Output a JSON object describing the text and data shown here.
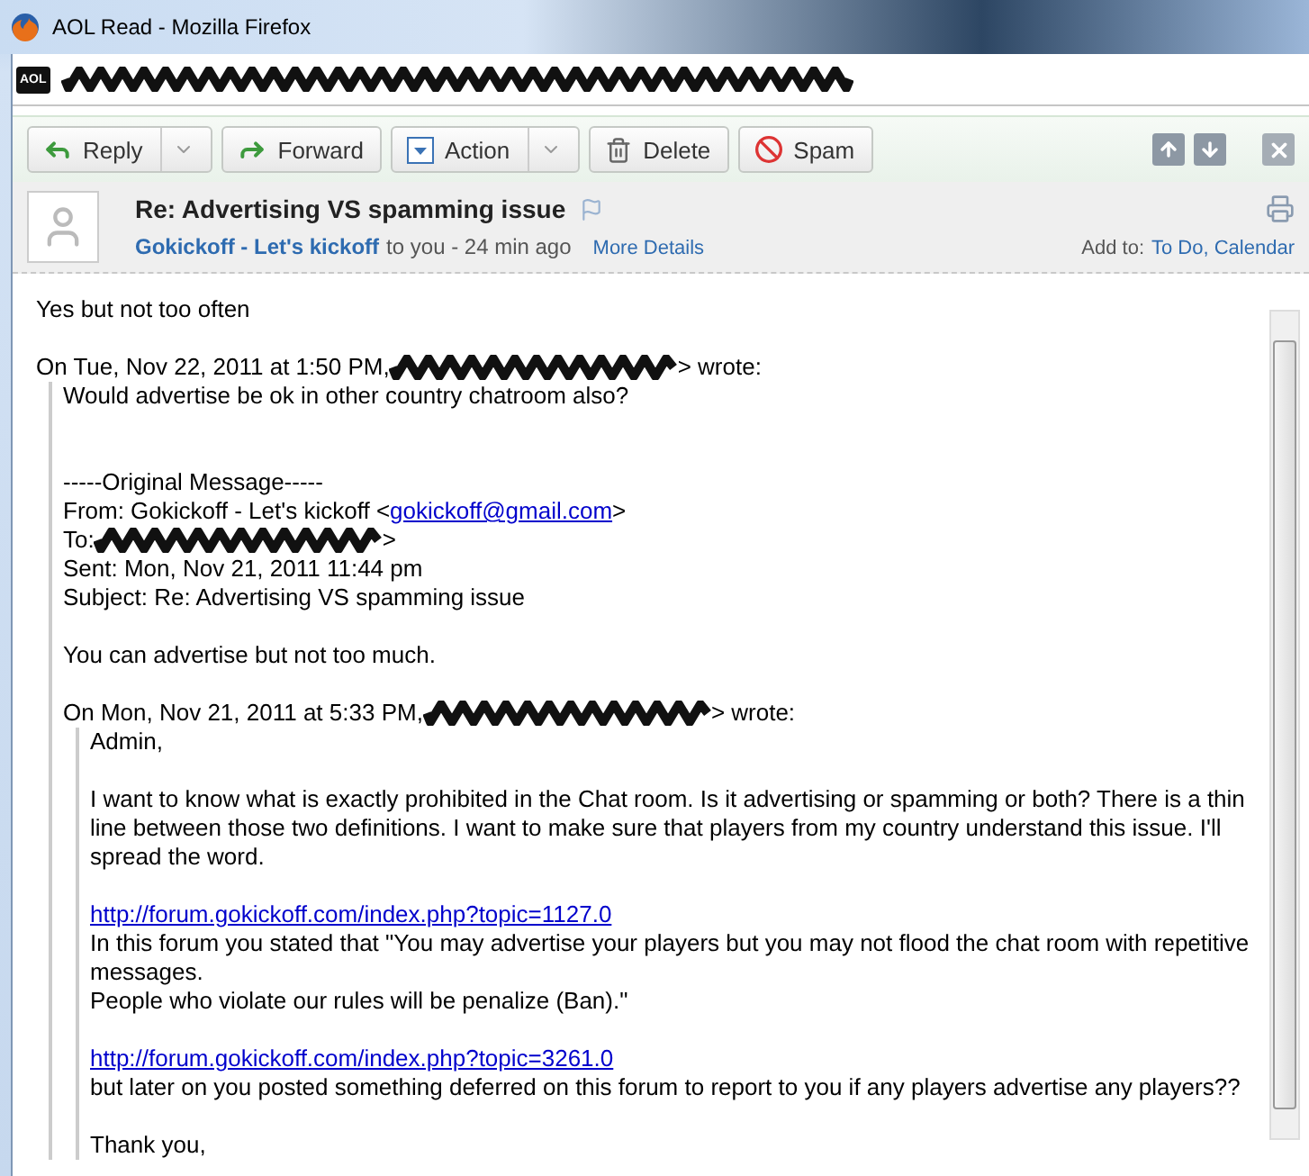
{
  "window": {
    "title": "AOL Read - Mozilla Firefox"
  },
  "address_bar": {
    "logo": "AOL",
    "redacted": true
  },
  "toolbar": {
    "buttons": [
      {
        "kind": "reply",
        "label": "Reply",
        "dropdown": true
      },
      {
        "kind": "forward",
        "label": "Forward",
        "dropdown": false
      },
      {
        "kind": "action",
        "label": "Action",
        "dropdown": true
      },
      {
        "kind": "delete",
        "label": "Delete",
        "dropdown": false
      },
      {
        "kind": "spam",
        "label": "Spam",
        "dropdown": false
      }
    ]
  },
  "message": {
    "subject": "Re: Advertising VS spamming issue",
    "sender": "Gokickoff - Let's kickoff",
    "recipient_info": "to you - 24 min ago",
    "details_link": "More Details",
    "add_to_label": "Add to:",
    "add_to_links": "To Do, Calendar"
  },
  "body": [
    {
      "kind": "para",
      "lines": [
        {
          "parts": [
            {
              "kind": "text",
              "text": "Yes but not too often"
            }
          ]
        }
      ]
    },
    {
      "kind": "attribution",
      "lines": [
        {
          "parts": [
            {
              "kind": "text",
              "text": "On Tue, Nov 22, 2011 at 1:50 PM,"
            },
            {
              "kind": "redaction"
            },
            {
              "kind": "text",
              "text": "> wrote:"
            }
          ]
        }
      ]
    },
    {
      "kind": "quote",
      "blocks": [
        {
          "kind": "para",
          "lines": [
            {
              "parts": [
                {
                  "kind": "text",
                  "text": "Would advertise be ok in other country chatroom also?"
                }
              ]
            }
          ]
        },
        {
          "kind": "para",
          "lines": [
            {
              "parts": [
                {
                  "kind": "text",
                  "text": "-----Original Message-----"
                }
              ]
            },
            {
              "parts": [
                {
                  "kind": "text",
                  "text": "From: Gokickoff - Let's kickoff <"
                },
                {
                  "kind": "link",
                  "text": "gokickoff@gmail.com"
                },
                {
                  "kind": "text",
                  "text": ">"
                }
              ]
            },
            {
              "parts": [
                {
                  "kind": "text",
                  "text": "To:"
                },
                {
                  "kind": "redaction"
                },
                {
                  "kind": "text",
                  "text": ">"
                }
              ]
            },
            {
              "parts": [
                {
                  "kind": "text",
                  "text": "Sent: Mon, Nov 21, 2011 11:44 pm"
                }
              ]
            },
            {
              "parts": [
                {
                  "kind": "text",
                  "text": "Subject: Re: Advertising VS spamming issue"
                }
              ]
            }
          ]
        },
        {
          "kind": "para",
          "lines": [
            {
              "parts": [
                {
                  "kind": "text",
                  "text": "You can advertise but not too much."
                }
              ]
            }
          ]
        },
        {
          "kind": "attribution",
          "lines": [
            {
              "parts": [
                {
                  "kind": "text",
                  "text": "On Mon, Nov 21, 2011 at 5:33 PM,"
                },
                {
                  "kind": "redaction"
                },
                {
                  "kind": "text",
                  "text": "> wrote:"
                }
              ]
            }
          ]
        },
        {
          "kind": "quote",
          "blocks": [
            {
              "kind": "para",
              "lines": [
                {
                  "parts": [
                    {
                      "kind": "text",
                      "text": "Admin,"
                    }
                  ]
                }
              ]
            },
            {
              "kind": "para",
              "lines": [
                {
                  "parts": [
                    {
                      "kind": "text",
                      "text": "I want to know what is exactly prohibited in the Chat room. Is it advertising or spamming or both? There is a thin line between those two definitions. I want to make sure that players from my country understand this issue. I'll spread the word."
                    }
                  ]
                }
              ]
            },
            {
              "kind": "para",
              "lines": [
                {
                  "parts": [
                    {
                      "kind": "link",
                      "text": "http://forum.gokickoff.com/index.php?topic=1127.0"
                    }
                  ]
                },
                {
                  "parts": [
                    {
                      "kind": "text",
                      "text": "In this forum you stated that \"You may advertise your players but you may not flood the chat room with repetitive messages."
                    }
                  ]
                },
                {
                  "parts": [
                    {
                      "kind": "text",
                      "text": "People who violate our rules will be penalize (Ban).\""
                    }
                  ]
                }
              ]
            },
            {
              "kind": "para",
              "lines": [
                {
                  "parts": [
                    {
                      "kind": "link",
                      "text": "http://forum.gokickoff.com/index.php?topic=3261.0"
                    }
                  ]
                },
                {
                  "parts": [
                    {
                      "kind": "text",
                      "text": "but later on you posted something deferred on this forum to report to you if any players advertise any players??"
                    }
                  ]
                }
              ]
            },
            {
              "kind": "para",
              "lines": [
                {
                  "parts": [
                    {
                      "kind": "text",
                      "text": "Thank you,"
                    }
                  ]
                }
              ]
            }
          ]
        }
      ]
    }
  ]
}
